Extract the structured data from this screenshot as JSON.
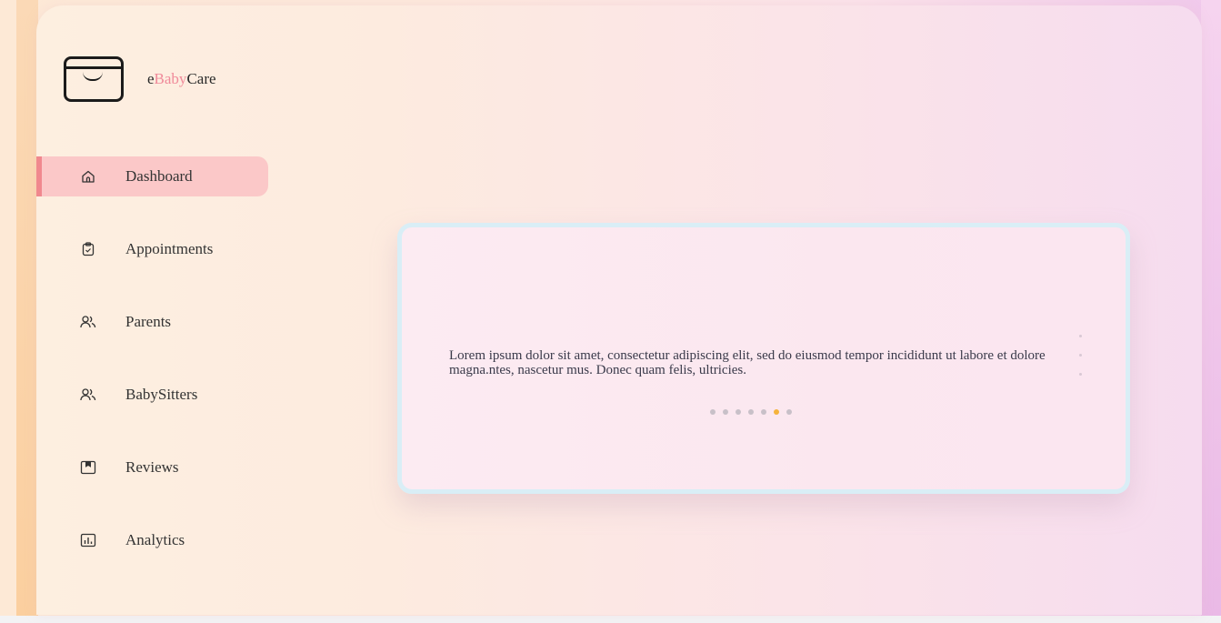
{
  "brand": {
    "prefix": "e",
    "accent": "Baby",
    "suffix": "Care",
    "accent_color": "#f08a9a"
  },
  "sidebar": {
    "items": [
      {
        "label": "Dashboard",
        "icon": "home-icon",
        "active": true
      },
      {
        "label": "Appointments",
        "icon": "clipboard-icon",
        "active": false
      },
      {
        "label": "Parents",
        "icon": "users-icon",
        "active": false
      },
      {
        "label": "BabySitters",
        "icon": "users-icon",
        "active": false
      },
      {
        "label": "Reviews",
        "icon": "bookmark-box-icon",
        "active": false
      },
      {
        "label": "Analytics",
        "icon": "chart-icon",
        "active": false
      }
    ],
    "active_color": "#fbc8c8",
    "active_bar_color": "#f0888e"
  },
  "carousel": {
    "text": "Lorem ipsum dolor sit amet, consectetur adipiscing elit, sed do eiusmod tempor incididunt ut labore et dolore magna.ntes, nascetur mus. Donec quam felis, ultricies.",
    "slide_count": 7,
    "active_index": 5,
    "active_dot_color": "#f5b33c"
  }
}
